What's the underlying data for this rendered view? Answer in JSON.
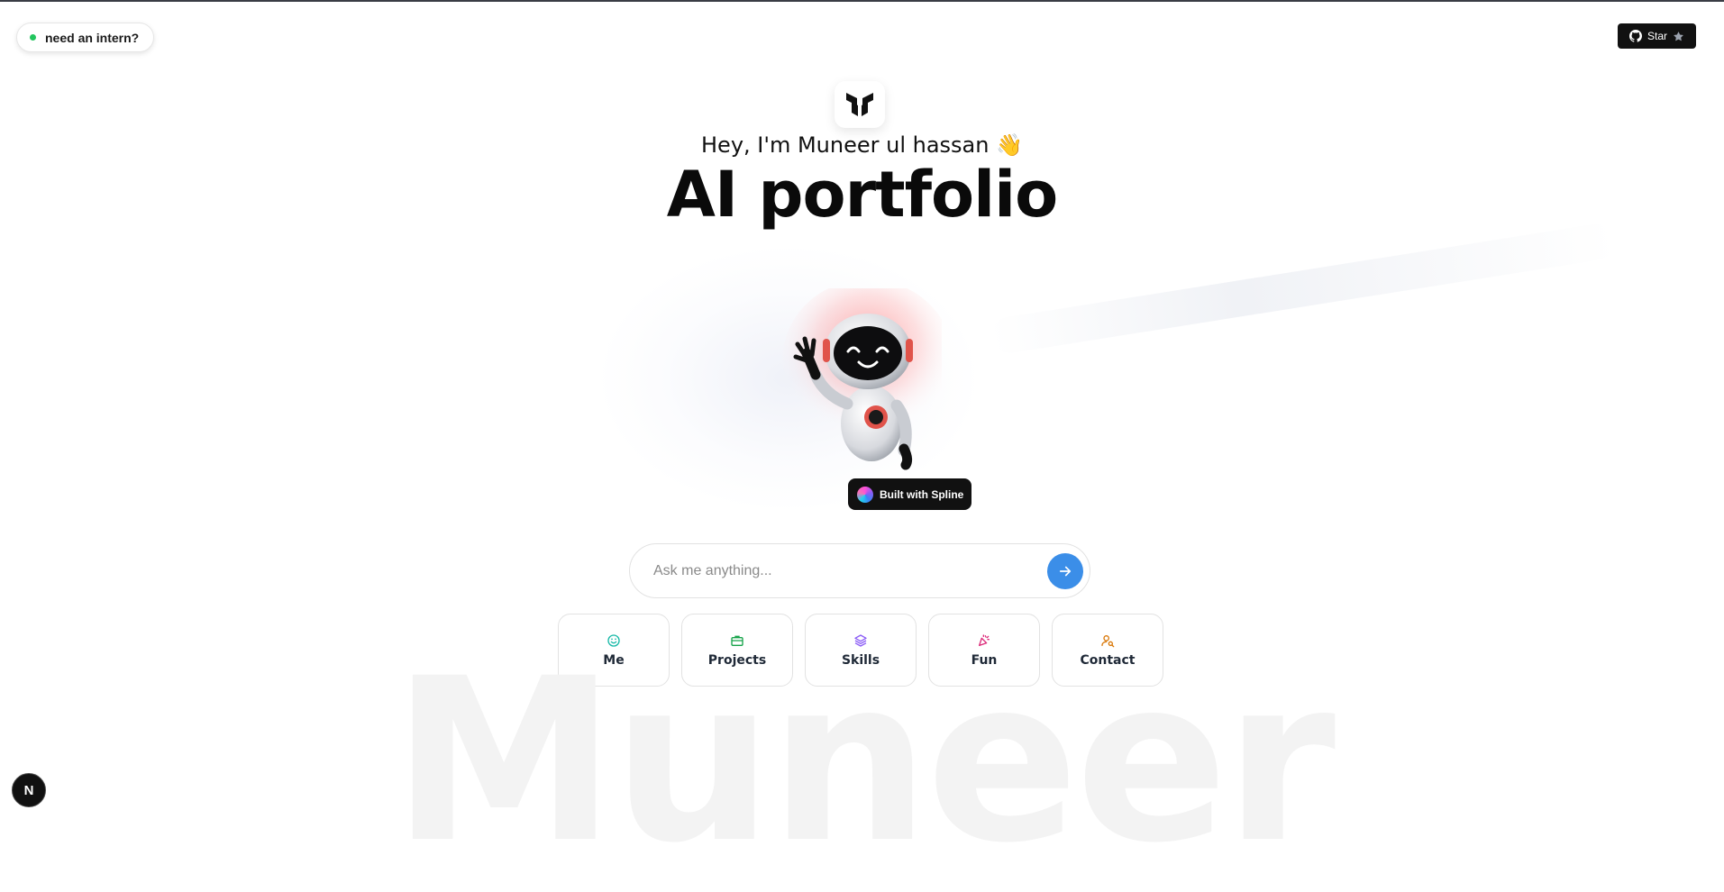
{
  "badge": {
    "label": "need an intern?",
    "status_color": "#22c55e"
  },
  "github": {
    "label": "Star",
    "icon": "github-icon"
  },
  "hero": {
    "greeting": "Hey, I'm Muneer ul hassan 👋",
    "title": "AI portfolio"
  },
  "spline": {
    "label": "Built with Spline"
  },
  "search": {
    "placeholder": "Ask me anything...",
    "value": ""
  },
  "tiles": [
    {
      "label": "Me",
      "icon": "smile-icon",
      "color": "#14b8a6"
    },
    {
      "label": "Projects",
      "icon": "briefcase-icon",
      "color": "#16a34a"
    },
    {
      "label": "Skills",
      "icon": "layers-icon",
      "color": "#8b5cf6"
    },
    {
      "label": "Fun",
      "icon": "party-popper-icon",
      "color": "#db2777"
    },
    {
      "label": "Contact",
      "icon": "user-search-icon",
      "color": "#d97706"
    }
  ],
  "watermark": "Muneer",
  "nextjs_badge": {
    "label": "N"
  },
  "colors": {
    "accent": "#3b8ee8",
    "text": "#111111"
  }
}
